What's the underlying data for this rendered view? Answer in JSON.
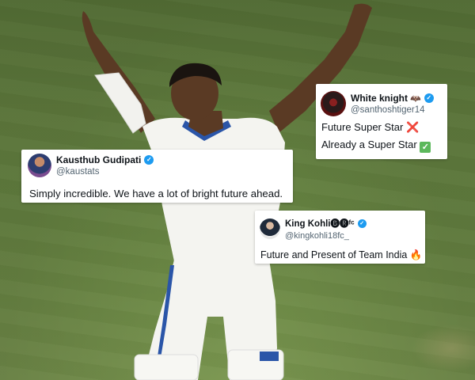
{
  "photo": {
    "subject": "player-celebrating-icon",
    "colors": {
      "field": "#6b8a45",
      "kit": "#f4f4f0",
      "stripe": "#2a55a8"
    }
  },
  "tweets": [
    {
      "id": "kaus",
      "display_name": "Kausthub Gudipati",
      "handle": "@kaustats",
      "verified": true,
      "text": "Simply incredible. We have a lot of bright future ahead."
    },
    {
      "id": "white",
      "display_name": "White knight",
      "name_emoji": "🦇",
      "handle": "@santhoshtiger14",
      "verified": true,
      "lines": [
        {
          "text": "Future Super Star",
          "emoji": "❌"
        },
        {
          "text": "Already a Super Star",
          "emoji": "✓"
        }
      ]
    },
    {
      "id": "king",
      "display_name": "King Kohli🅑🅡ᶠᶜ",
      "handle": "@kingkohli18fc_",
      "verified": true,
      "text": "Future and Present of Team India",
      "emoji": "🔥"
    }
  ],
  "icons": {
    "verified": "verified-badge-icon",
    "check_glyph": "✓"
  }
}
